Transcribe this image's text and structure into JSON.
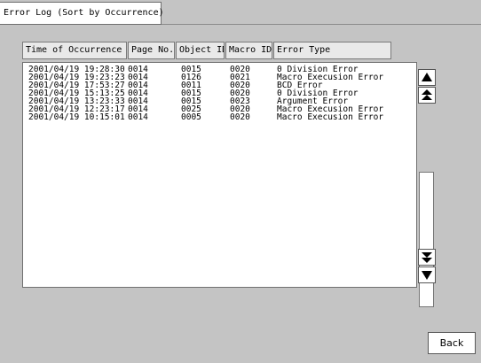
{
  "tab": {
    "label": "Error Log (Sort by Occurrence)"
  },
  "columns": [
    "Time of Occurrence",
    "Page No.",
    "Object ID",
    "Macro ID",
    "Error Type"
  ],
  "rows": [
    [
      "2001/04/19 19:28:30",
      "0014",
      "0015",
      "0020",
      "0 Division Error"
    ],
    [
      "2001/04/19 19:23:23",
      "0014",
      "0126",
      "0021",
      "Macro Execusion Error"
    ],
    [
      "2001/04/19 17:53:27",
      "0014",
      "0011",
      "0020",
      "BCD Error"
    ],
    [
      "2001/04/19 15:13:25",
      "0014",
      "0015",
      "0020",
      "0 Division Error"
    ],
    [
      "2001/04/19 13:23:33",
      "0014",
      "0015",
      "0023",
      "Argument Error"
    ],
    [
      "2001/04/19 12:23:17",
      "0014",
      "0025",
      "0020",
      "Macro Execusion Error"
    ],
    [
      "2001/04/19 10:15:01",
      "0014",
      "0005",
      "0020",
      "Macro Execusion Error"
    ]
  ],
  "scrollbar": {
    "up_icon": "scroll-up-icon",
    "page_up_icon": "page-up-icon",
    "page_down_icon": "page-down-icon",
    "down_icon": "scroll-down-icon"
  },
  "buttons": {
    "back": "Back"
  }
}
